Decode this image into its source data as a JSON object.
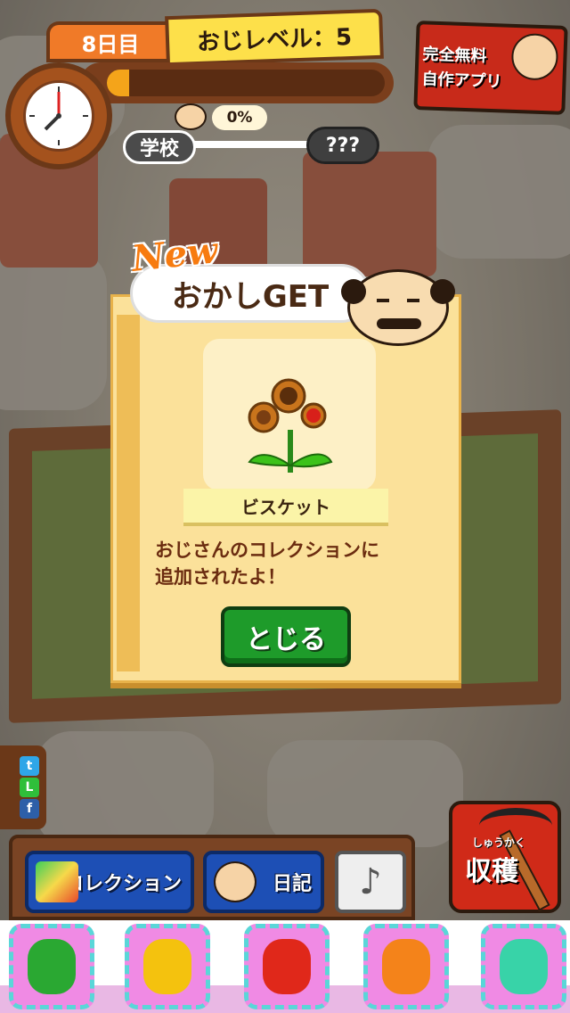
{
  "header": {
    "day_label": "8日目",
    "level_label": "おじレベル：5",
    "progress_fraction": 0.08,
    "percent_label": "0%",
    "school_label": "学校",
    "unknown_label": "???"
  },
  "ad_banner": {
    "line1": "完全無料",
    "line2": "自作アプリ"
  },
  "popup": {
    "new_label": "New",
    "title": "おかしGET",
    "item_name": "ビスケット",
    "message_line1": "おじさんのコレクションに",
    "message_line2": "追加されたよ！",
    "close_label": "とじる"
  },
  "social": {
    "items": [
      {
        "icon": "twitter-icon",
        "color": "#2fa6e8",
        "glyph": "t"
      },
      {
        "icon": "line-icon",
        "color": "#2fbf3a",
        "glyph": "L"
      },
      {
        "icon": "facebook-icon",
        "color": "#2d5fa8",
        "glyph": "f"
      }
    ]
  },
  "toolbar": {
    "collection_label": "コレクション",
    "diary_label": "日記",
    "music_glyph": "♪"
  },
  "harvest": {
    "ruby": "しゅうかく",
    "label": "収穫"
  },
  "candies": [
    {
      "icon": "green-candy-icon",
      "color": "#2aa832"
    },
    {
      "icon": "yellow-candy-icon",
      "color": "#f4c20e"
    },
    {
      "icon": "red-candy-icon",
      "color": "#e0281a"
    },
    {
      "icon": "orange-candy-icon",
      "color": "#f4831a"
    },
    {
      "icon": "teal-gummy-bear-icon",
      "color": "#38d3a8"
    }
  ]
}
